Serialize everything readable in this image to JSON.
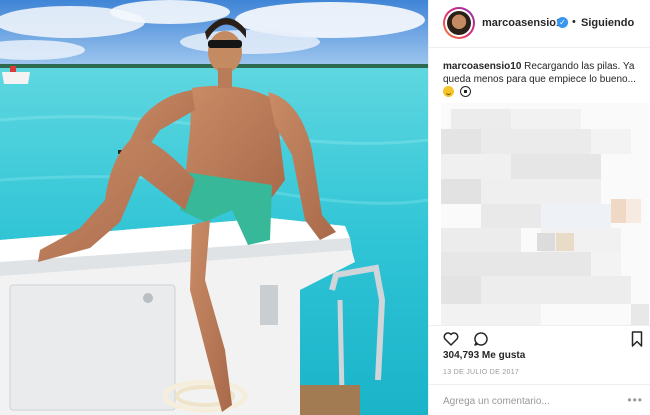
{
  "post": {
    "author": "marcoasensio10",
    "verified_icon": "verified-badge-icon",
    "separator": "•",
    "follow_state": "Siguiendo",
    "caption_user": "marcoasensio10",
    "caption_text": "Recargando las pilas. Ya queda menos para que empiece lo bueno...",
    "caption_emojis": [
      "grinning-face-icon",
      "soccer-ball-icon"
    ],
    "likes": "304,793 Me gusta",
    "date": "13 DE JULIO DE 2017",
    "comment_placeholder": "Agrega un comentario...",
    "more_label": "•••"
  },
  "colors": {
    "sea": "#3fd0d8",
    "sky": "#4a9ae0",
    "link_blue": "#3897f0",
    "border": "#efefef",
    "meta_gray": "#999999"
  }
}
